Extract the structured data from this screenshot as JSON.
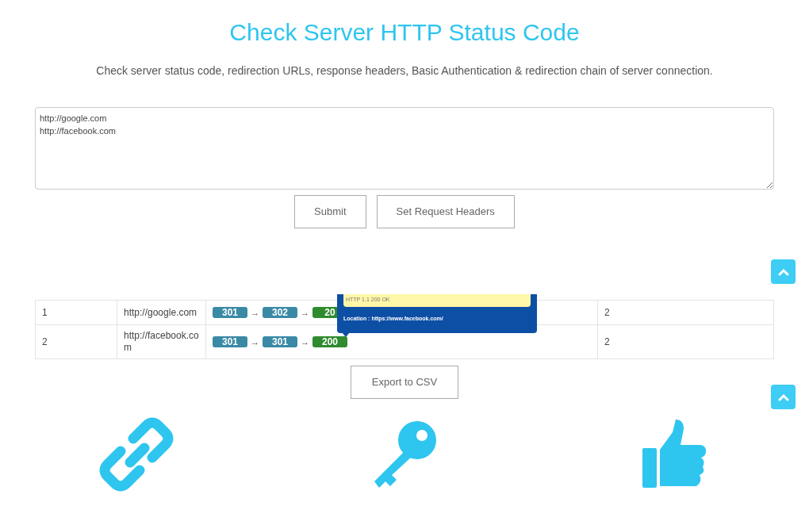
{
  "title": "Check Server HTTP Status Code",
  "subtitle": "Check server status code, redirection URLs, response headers, Basic Authentication & redirection chain of server connection.",
  "url_input": {
    "value": "http://google.com\nhttp://facebook.com"
  },
  "buttons": [
    "Submit",
    "Set Request Headers"
  ],
  "results": [
    {
      "index": "1",
      "url": "http://google.com",
      "chain": [
        {
          "code": "301",
          "kind": "redirect"
        },
        {
          "code": "302",
          "kind": "redirect"
        },
        {
          "code": "20",
          "kind": "ok"
        }
      ],
      "count": "2"
    },
    {
      "index": "2",
      "url": "http://facebook.com",
      "chain": [
        {
          "code": "301",
          "kind": "redirect"
        },
        {
          "code": "301",
          "kind": "redirect"
        },
        {
          "code": "200",
          "kind": "ok"
        }
      ],
      "count": "2"
    }
  ],
  "arrow": "→",
  "tooltip": {
    "status": "HTTP 1.1 200 OK",
    "location": "Location : https://www.facebook.com/"
  },
  "export_button": "Export to CSV"
}
